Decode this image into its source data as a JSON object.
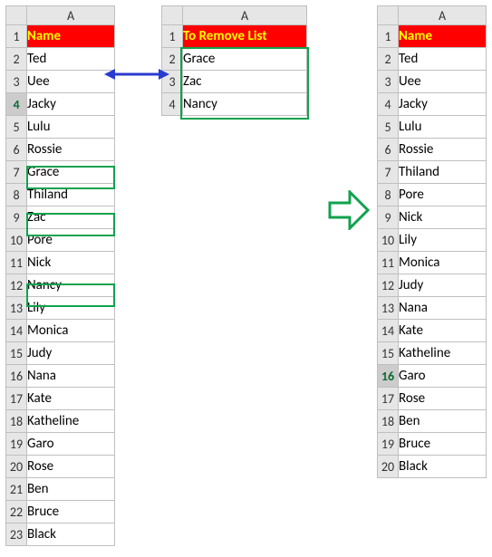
{
  "left": {
    "col_label": "A",
    "header": "Name",
    "selected_row_index": 4,
    "rows": [
      "Ted",
      "Uee",
      "Jacky",
      "Lulu",
      "Rossie",
      "Grace",
      "Thiland",
      "Zac",
      "Pore",
      "Nick",
      "Nancy",
      "Lily",
      "Monica",
      "Judy",
      "Nana",
      "Kate",
      "Katheline",
      "Garo",
      "Rose",
      "Ben",
      "Bruce",
      "Black"
    ],
    "highlighted_rows": [
      7,
      9,
      12
    ]
  },
  "remove": {
    "col_label": "A",
    "header": "To Remove List",
    "rows": [
      "Grace",
      "Zac",
      "Nancy"
    ]
  },
  "right": {
    "col_label": "A",
    "header": "Name",
    "selected_row_index": 16,
    "rows": [
      "Ted",
      "Uee",
      "Jacky",
      "Lulu",
      "Rossie",
      "Thiland",
      "Pore",
      "Nick",
      "Lily",
      "Monica",
      "Judy",
      "Nana",
      "Kate",
      "Katheline",
      "Garo",
      "Rose",
      "Ben",
      "Bruce",
      "Black"
    ]
  },
  "arrows": {
    "double": "↔",
    "block": "⇨"
  },
  "colors": {
    "header_bg": "#ff0000",
    "header_fg": "#ffff00",
    "highlight": "#11a24e",
    "double_arrow": "#2a3bcf"
  }
}
